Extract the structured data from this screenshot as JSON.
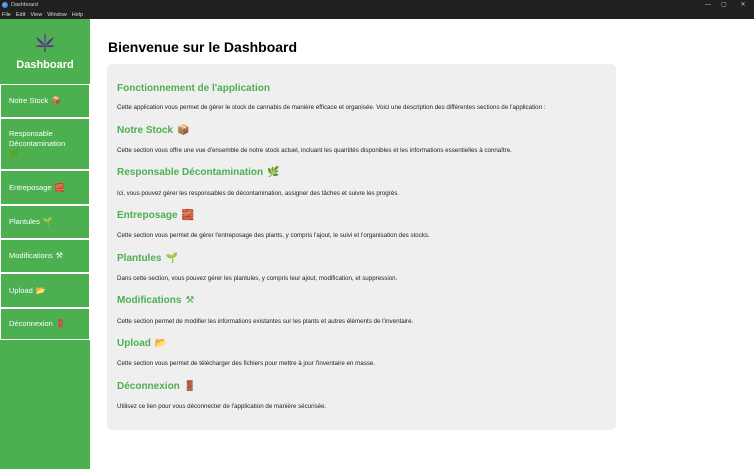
{
  "window": {
    "title": "Dashboard",
    "controls": [
      "—",
      "▢",
      "✕"
    ]
  },
  "menu": [
    "File",
    "Edit",
    "View",
    "Window",
    "Help"
  ],
  "sidebar": {
    "brand": "Dashboard",
    "items": [
      {
        "label": "Notre Stock",
        "icon": "📦"
      },
      {
        "label": "Responsable Décontamination",
        "icon": "🌿"
      },
      {
        "label": "Entreposage",
        "icon": "🧱"
      },
      {
        "label": "Plantules",
        "icon": "🌱"
      },
      {
        "label": "Modifications",
        "icon": "⚒"
      },
      {
        "label": "Upload",
        "icon": "📂"
      },
      {
        "label": "Déconnexion",
        "icon": "🚪"
      }
    ]
  },
  "main": {
    "title": "Bienvenue sur le Dashboard",
    "sections": [
      {
        "title": "Fonctionnement de l'application",
        "icon": "",
        "desc": "Cette application vous permet de gérer le stock de cannabis de manière efficace et organisée. Voici une description des différentes sections de l'application :"
      },
      {
        "title": "Notre Stock",
        "icon": "📦",
        "desc": "Cette section vous offre une vue d'ensemble de notre stock actuel, incluant les quantités disponibles et les informations essentielles à connaître."
      },
      {
        "title": "Responsable Décontamination",
        "icon": "🌿",
        "desc": "Ici, vous pouvez gérer les responsables de décontamination, assigner des tâches et suivre les progrès."
      },
      {
        "title": "Entreposage",
        "icon": "🧱",
        "desc": "Cette section vous permet de gérer l'entreposage des plants, y compris l'ajout, le suivi et l'organisation des stocks."
      },
      {
        "title": "Plantules",
        "icon": "🌱",
        "desc": "Dans cette section, vous pouvez gérer les plantules, y compris leur ajout, modification, et suppression."
      },
      {
        "title": "Modifications",
        "icon": "⚒",
        "desc": "Cette section permet de modifier les informations existantes sur les plants et autres éléments de l'inventaire."
      },
      {
        "title": "Upload",
        "icon": "📂",
        "desc": "Cette section vous permet de télécharger des fichiers pour mettre à jour l'inventaire en masse."
      },
      {
        "title": "Déconnexion",
        "icon": "🚪",
        "desc": "Utilisez ce lien pour vous déconnecter de l'application de manière sécurisée."
      }
    ]
  },
  "colors": {
    "accent": "#4caf50",
    "card": "#efefef",
    "titlebar": "#202020"
  }
}
